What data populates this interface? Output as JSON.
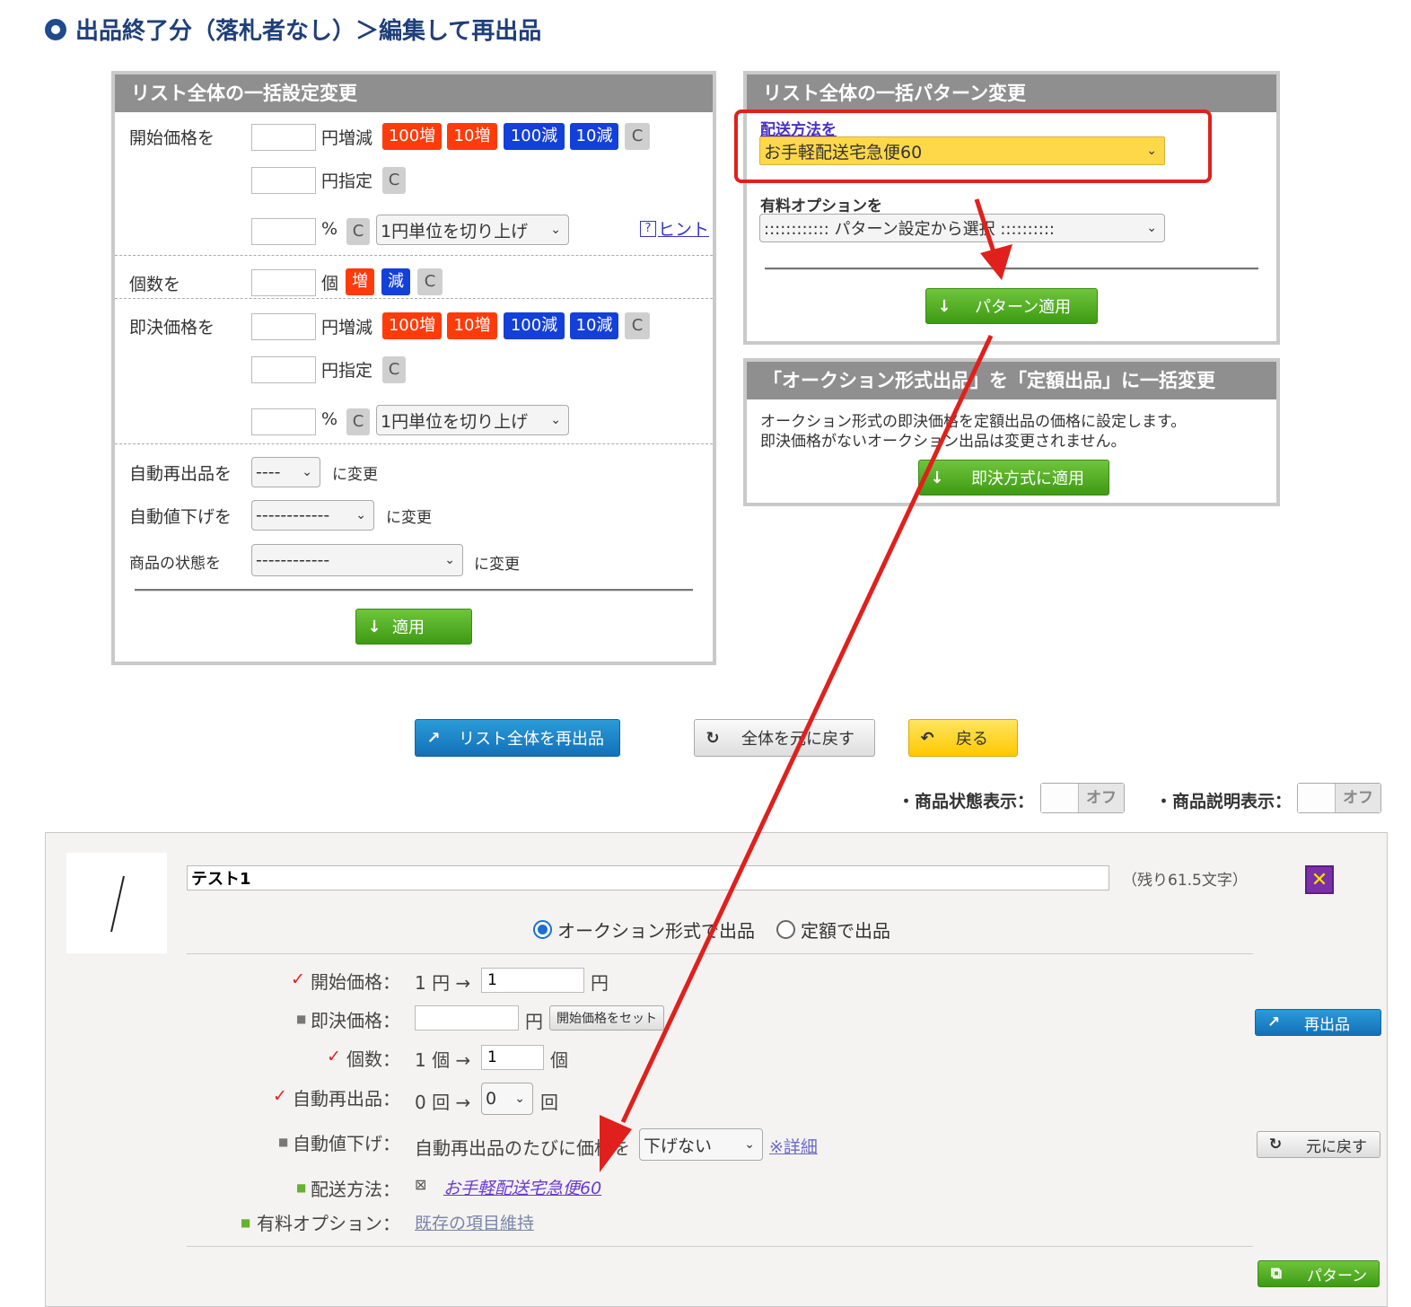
{
  "page": {
    "title": "出品終了分（落札者なし）＞編集して再出品"
  },
  "bulk_settings": {
    "header": "リスト全体の一括設定変更",
    "start_price": {
      "label": "開始価格を",
      "unit_increase": "円増減",
      "unit_specify": "円指定",
      "percent": "%",
      "rounding": "1円単位を切り上げ"
    },
    "chips": {
      "inc100": "100増",
      "inc10": "10増",
      "dec100": "100減",
      "dec10": "10減",
      "clear": "C",
      "inc": "増",
      "dec": "減"
    },
    "hint": "ヒント",
    "hint_icon": "?",
    "quantity": {
      "label": "個数を",
      "unit": "個"
    },
    "buyout_price": {
      "label": "即決価格を",
      "unit_increase": "円増減",
      "unit_specify": "円指定",
      "percent": "%",
      "rounding": "1円単位を切り上げ"
    },
    "auto_relist": {
      "label": "自動再出品を",
      "value": "----",
      "suffix": "に変更"
    },
    "auto_price_down": {
      "label": "自動値下げを",
      "value": "------------",
      "suffix": "に変更"
    },
    "item_condition": {
      "label": "商品の状態を",
      "value": "------------",
      "suffix": "に変更"
    },
    "apply_button": "適用"
  },
  "bulk_pattern": {
    "header": "リスト全体の一括パターン変更",
    "shipping_link": "配送方法を",
    "shipping_value": "お手軽配送宅急便60",
    "paid_option_label": "有料オプションを",
    "paid_option_value": ":::::::::::: パターン設定から選択 ::::::::::",
    "apply_button": "パターン適用"
  },
  "auction_convert": {
    "header": "「オークション形式出品」を「定額出品」に一括変更",
    "line1": "オークション形式の即決価格を定額出品の価格に設定します。",
    "line2": "即決価格がないオークション出品は変更されません。",
    "apply_button": "即決方式に適用"
  },
  "actions": {
    "relist_all": "リスト全体を再出品",
    "reset_all": "全体を元に戻す",
    "back": "戻る"
  },
  "toggles": {
    "condition_label": "・商品状態表示：",
    "condition_state": "オフ",
    "description_label": "・商品説明表示：",
    "description_state": "オフ"
  },
  "item": {
    "title_value": "テスト1",
    "remaining": "（残り61.5文字）",
    "format_auction": "オークション形式で出品",
    "format_fixed": "定額で出品",
    "start_price": {
      "label": "開始価格：",
      "current": "1 円 →",
      "input": "1",
      "unit": "円"
    },
    "buyout_price": {
      "label": "即決価格：",
      "unit": "円",
      "set_button": "開始価格をセット"
    },
    "quantity": {
      "label": "個数：",
      "current": "1 個 →",
      "input": "1",
      "unit": "個"
    },
    "auto_relist": {
      "label": "自動再出品：",
      "current": "0 回 →",
      "value": "0",
      "unit": "回"
    },
    "auto_price_down": {
      "label": "自動値下げ：",
      "text": "自動再出品のたびに価格を",
      "value": "下げない",
      "detail": "※詳細"
    },
    "shipping": {
      "label": "配送方法：",
      "value": "お手軽配送宅急便60"
    },
    "paid_option": {
      "label": "有料オプション：",
      "value": "既存の項目維持"
    },
    "relist_button": "再出品",
    "reset_button": "元に戻す",
    "pattern_button": "パターン"
  },
  "colors": {
    "accent": "#1f3f7a",
    "annotation": "#e0201c",
    "highlight": "#ffd84a",
    "green": "#4aa51c",
    "blue": "#1a7fc4"
  }
}
